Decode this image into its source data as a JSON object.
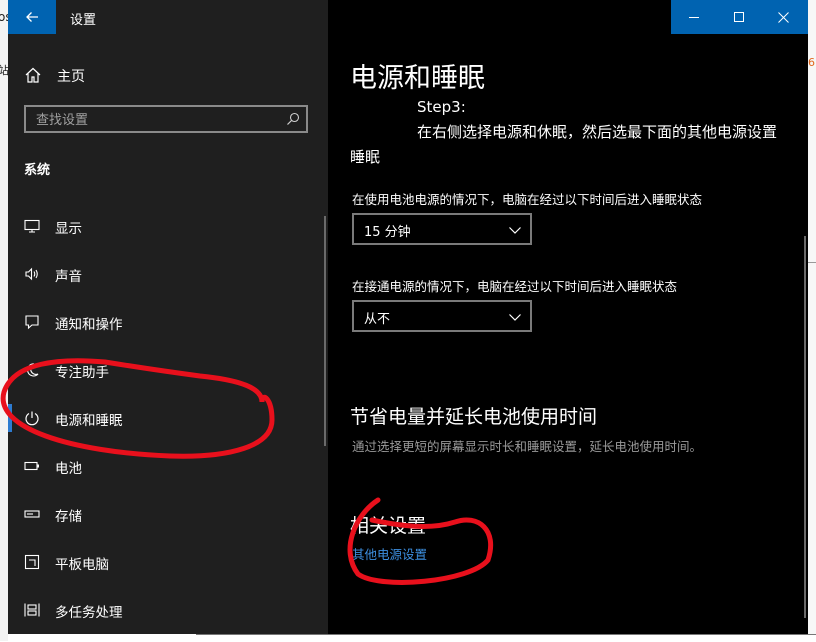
{
  "background": {
    "left_fragment": "os",
    "left_fragment2": "站",
    "right_fragment": "6"
  },
  "window": {
    "title": "设置",
    "colors": {
      "accent": "#0063b1",
      "sidebar": "#1f1f1f",
      "content": "#000000",
      "link": "#3d8fe0",
      "annotation": "#e8101c"
    }
  },
  "sidebar": {
    "home_label": "主页",
    "search_placeholder": "查找设置",
    "section_title": "系统",
    "items": [
      {
        "label": "显示",
        "icon": "monitor-icon"
      },
      {
        "label": "声音",
        "icon": "speaker-icon"
      },
      {
        "label": "通知和操作",
        "icon": "notification-icon"
      },
      {
        "label": "专注助手",
        "icon": "moon-icon"
      },
      {
        "label": "电源和睡眠",
        "icon": "power-icon",
        "active": true
      },
      {
        "label": "电池",
        "icon": "battery-icon"
      },
      {
        "label": "存储",
        "icon": "storage-icon"
      },
      {
        "label": "平板电脑",
        "icon": "tablet-icon"
      },
      {
        "label": "多任务处理",
        "icon": "multitask-icon"
      }
    ]
  },
  "main": {
    "page_title": "电源和睡眠",
    "note_step": "Step3:",
    "note_line1": "在右侧选择电源和休眠，然后选最下面的其他电源设置",
    "note_line2": "睡眠",
    "battery_label": "在使用电池电源的情况下，电脑在经过以下时间后进入睡眠状态",
    "battery_value": "15 分钟",
    "plugged_label": "在接通电源的情况下，电脑在经过以下时间后进入睡眠状态",
    "plugged_value": "从不",
    "save_title": "节省电量并延长电池使用时间",
    "save_desc": "通过选择更短的屏幕显示时长和睡眠设置，延长电池使用时间。",
    "related_title": "相关设置",
    "related_link": "其他电源设置"
  }
}
